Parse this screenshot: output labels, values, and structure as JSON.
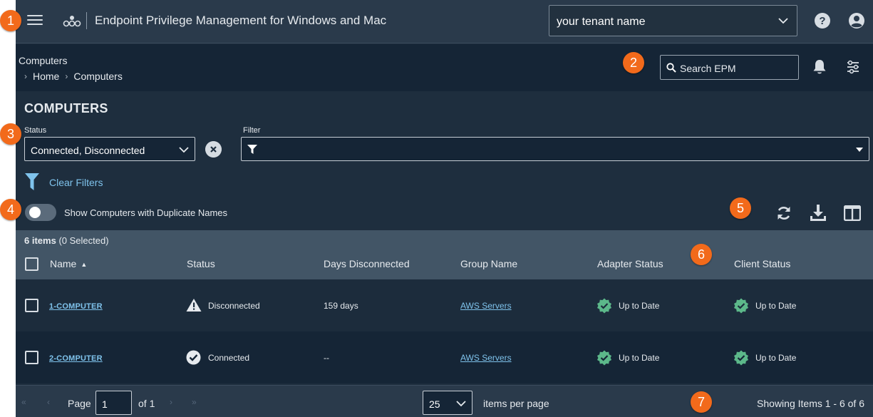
{
  "header": {
    "app_title": "Endpoint Privilege Management for Windows and Mac",
    "tenant_value": "your tenant name"
  },
  "breadcrumb": {
    "title": "Computers",
    "items": [
      "Home",
      "Computers"
    ],
    "search_placeholder": "Search EPM"
  },
  "page": {
    "title": "COMPUTERS",
    "status_label": "Status",
    "status_value": "Connected, Disconnected",
    "filter_label": "Filter",
    "clear_filters": "Clear Filters",
    "toggle_label": "Show Computers with Duplicate Names"
  },
  "grid": {
    "count_bold": "6 items",
    "count_rest": "(0 Selected)",
    "columns": [
      "Name",
      "Status",
      "Days Disconnected",
      "Group Name",
      "Adapter Status",
      "Client Status"
    ],
    "rows": [
      {
        "name": "1-COMPUTER",
        "status": "Disconnected",
        "days": "159 days",
        "group": "AWS Servers",
        "adapter": "Up to Date",
        "client": "Up to Date"
      },
      {
        "name": "2-COMPUTER",
        "status": "Connected",
        "days": "--",
        "group": "AWS Servers",
        "adapter": "Up to Date",
        "client": "Up to Date"
      }
    ]
  },
  "footer": {
    "page_label": "Page",
    "page_value": "1",
    "of_label": "of 1",
    "per_page_value": "25",
    "per_page_label": "items per page",
    "showing": "Showing Items 1 - 6 of 6"
  },
  "callouts": [
    "1",
    "2",
    "3",
    "4",
    "5",
    "6",
    "7"
  ],
  "colors": {
    "accent": "#f26a1b",
    "link": "#7fc3ec",
    "success": "#5cb88a",
    "background": "#1e2e3e"
  }
}
